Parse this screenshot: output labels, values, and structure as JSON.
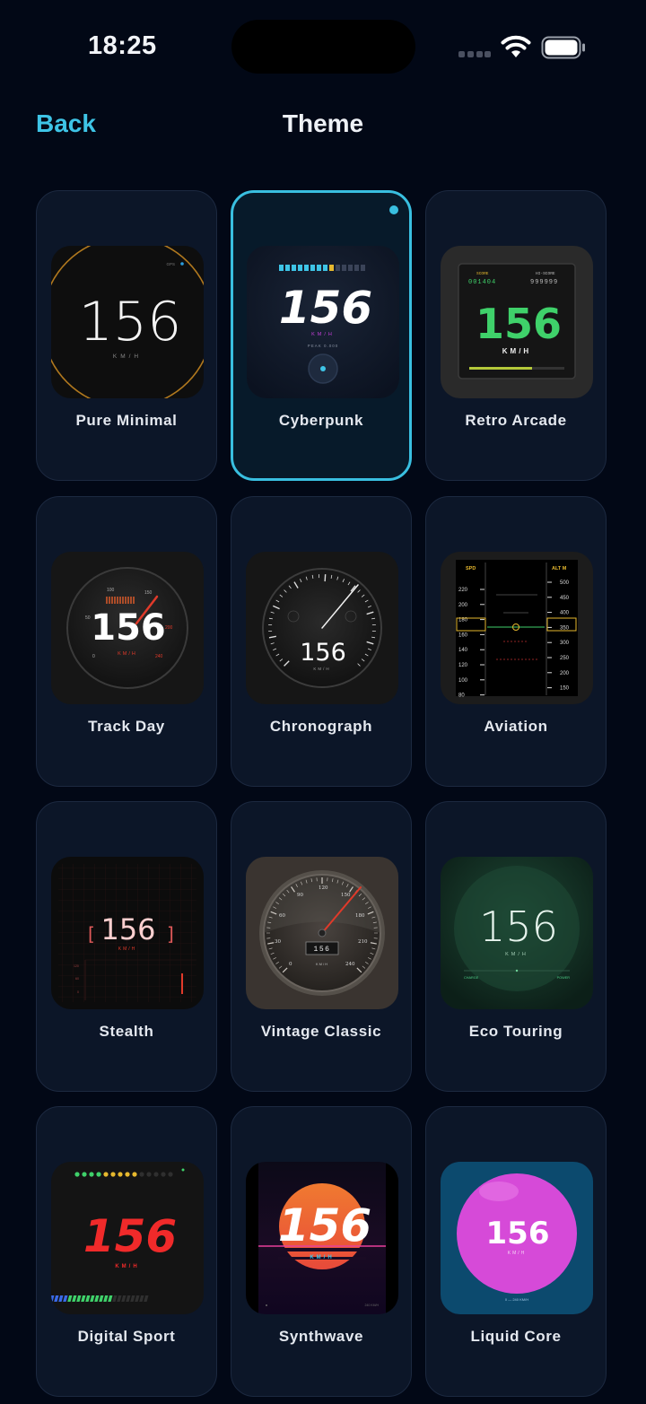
{
  "status_bar": {
    "time": "18:25"
  },
  "nav": {
    "back_label": "Back",
    "title": "Theme"
  },
  "selected_theme": "Cyberpunk",
  "accent_color": "#39bfe0",
  "themes": [
    {
      "label": "Pure Minimal",
      "speed": "156",
      "unit": "KM/H",
      "mode": "GPS"
    },
    {
      "label": "Cyberpunk",
      "speed": "156",
      "unit": "KM/H",
      "peak": "PEAK 0.000"
    },
    {
      "label": "Retro Arcade",
      "speed": "156",
      "unit": "KM/H",
      "score_label": "SCORE",
      "score": "001404",
      "hiscore_label": "HI-SCORE",
      "hiscore": "999999"
    },
    {
      "label": "Track Day",
      "speed": "156",
      "unit": "KM/H",
      "ticks": [
        "50",
        "100",
        "150",
        "200",
        "240",
        "0"
      ]
    },
    {
      "label": "Chronograph",
      "speed": "156",
      "unit": "KM/H"
    },
    {
      "label": "Aviation",
      "spd_label": "SPD",
      "alt_label": "ALT M",
      "spd_ticks": [
        "220",
        "200",
        "180",
        "160",
        "140",
        "120",
        "100",
        "80"
      ],
      "alt_ticks": [
        "500",
        "450",
        "400",
        "350",
        "300",
        "250",
        "200",
        "150"
      ]
    },
    {
      "label": "Stealth",
      "speed": "156",
      "unit": "KM/H",
      "scale": [
        "120",
        "60",
        "0"
      ]
    },
    {
      "label": "Vintage Classic",
      "speed": "156",
      "unit": "KM/H",
      "ticks": [
        "90",
        "120",
        "150",
        "60",
        "180",
        "30",
        "210",
        "0",
        "240"
      ]
    },
    {
      "label": "Eco Touring",
      "speed": "156",
      "unit": "KM/H",
      "left_label": "CHARGE",
      "right_label": "POWER"
    },
    {
      "label": "Digital Sport",
      "speed": "156",
      "unit": "KM/H"
    },
    {
      "label": "Synthwave",
      "speed": "156",
      "unit": "KM/H",
      "foot": "240 KM/H"
    },
    {
      "label": "Liquid Core",
      "speed": "156",
      "unit": "KM/H",
      "range": "0 — 240 KM/H"
    }
  ]
}
